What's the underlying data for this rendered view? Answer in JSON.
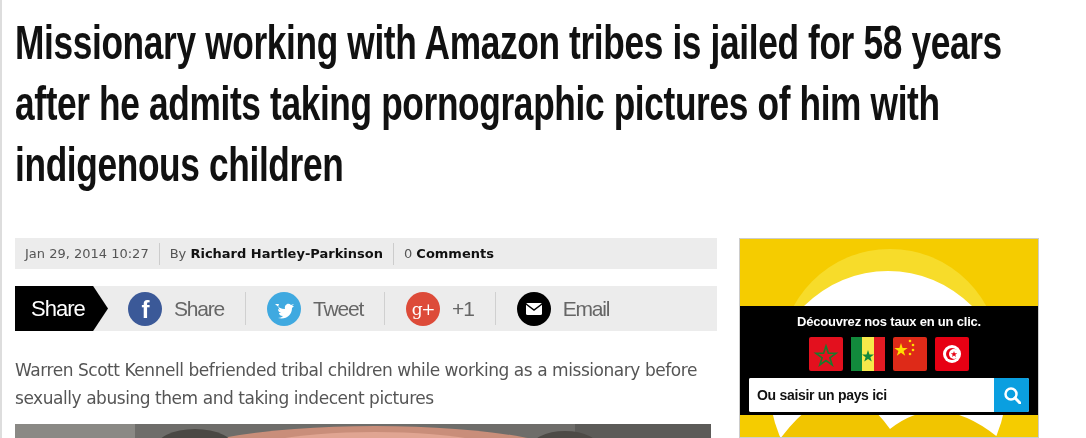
{
  "headline": "Missionary working with Amazon tribes is jailed for 58 years after he admits taking pornographic pictures of him with indigenous children",
  "meta": {
    "date": "Jan 29, 2014 10:27",
    "by_label": "By",
    "author": "Richard Hartley-Parkinson",
    "comment_count": "0",
    "comments_label": "Comments"
  },
  "share": {
    "label": "Share",
    "buttons": [
      {
        "kind": "facebook",
        "glyph": "f",
        "label": "Share"
      },
      {
        "kind": "twitter",
        "label": "Tweet"
      },
      {
        "kind": "googleplus",
        "glyph": "g+",
        "label": "+1"
      },
      {
        "kind": "email",
        "label": "Email"
      }
    ]
  },
  "summary": "Warren Scott Kennell befriended tribal children while working as a missionary before sexually abusing them and taking indecent pictures",
  "ad": {
    "tagline": "Découvrez nos taux en un clic.",
    "flags": [
      {
        "kind": "morocco"
      },
      {
        "kind": "senegal"
      },
      {
        "kind": "china"
      },
      {
        "kind": "tunisia"
      }
    ],
    "search": {
      "placeholder": "Ou saisir un pays ici"
    }
  }
}
